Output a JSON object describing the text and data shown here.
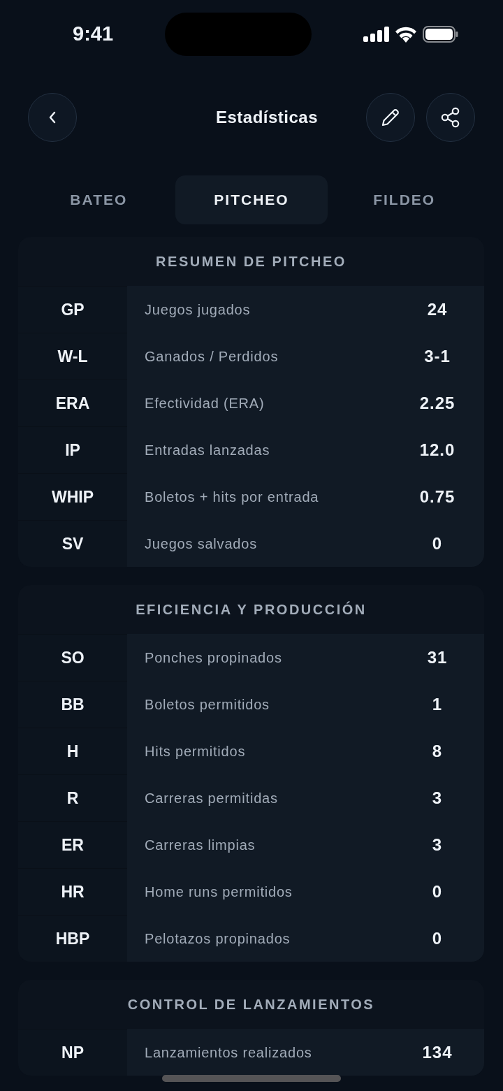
{
  "status_bar": {
    "time": "9:41"
  },
  "header": {
    "title": "Estadísticas"
  },
  "tabs": [
    {
      "label": "BATEO",
      "selected": false
    },
    {
      "label": "PITCHEO",
      "selected": true
    },
    {
      "label": "FILDEO",
      "selected": false
    }
  ],
  "sections": [
    {
      "title": "RESUMEN DE PITCHEO",
      "rows": [
        {
          "abbr": "GP",
          "label": "Juegos jugados",
          "value": "24"
        },
        {
          "abbr": "W-L",
          "label": "Ganados / Perdidos",
          "value": "3-1"
        },
        {
          "abbr": "ERA",
          "label": "Efectividad (ERA)",
          "value": "2.25"
        },
        {
          "abbr": "IP",
          "label": "Entradas lanzadas",
          "value": "12.0"
        },
        {
          "abbr": "WHIP",
          "label": "Boletos + hits por entrada",
          "value": "0.75"
        },
        {
          "abbr": "SV",
          "label": "Juegos salvados",
          "value": "0"
        }
      ]
    },
    {
      "title": "EFICIENCIA Y PRODUCCIÓN",
      "rows": [
        {
          "abbr": "SO",
          "label": "Ponches propinados",
          "value": "31"
        },
        {
          "abbr": "BB",
          "label": "Boletos permitidos",
          "value": "1"
        },
        {
          "abbr": "H",
          "label": "Hits permitidos",
          "value": "8"
        },
        {
          "abbr": "R",
          "label": "Carreras permitidas",
          "value": "3"
        },
        {
          "abbr": "ER",
          "label": "Carreras limpias",
          "value": "3"
        },
        {
          "abbr": "HR",
          "label": "Home runs permitidos",
          "value": "0"
        },
        {
          "abbr": "HBP",
          "label": "Pelotazos propinados",
          "value": "0"
        }
      ]
    },
    {
      "title": "CONTROL DE LANZAMIENTOS",
      "rows": [
        {
          "abbr": "NP",
          "label": "Lanzamientos realizados",
          "value": "134"
        }
      ]
    }
  ]
}
